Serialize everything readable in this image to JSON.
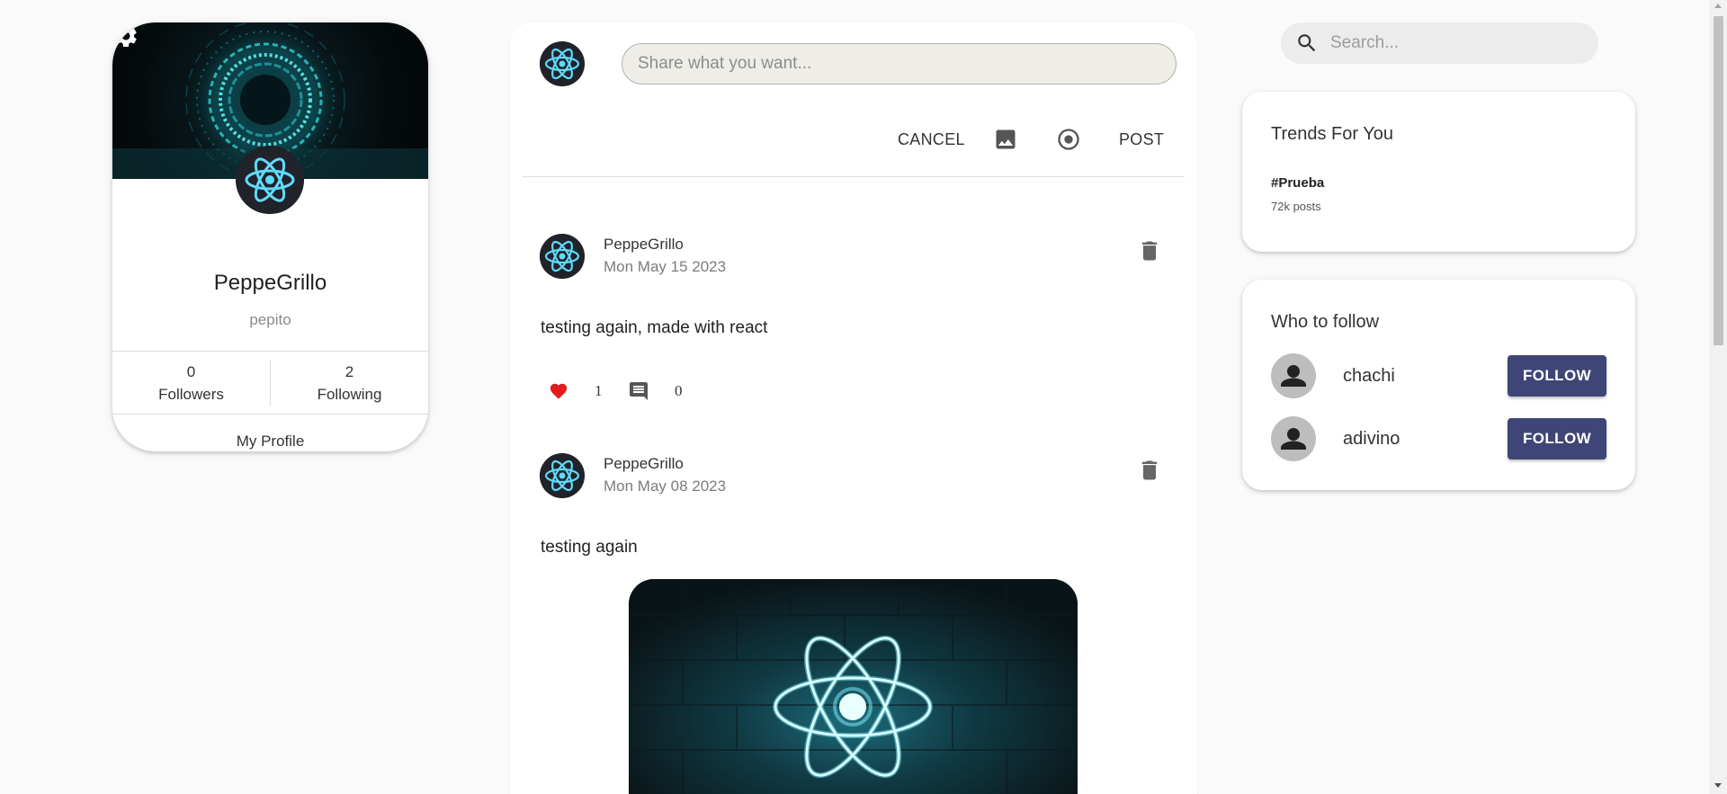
{
  "profile": {
    "display_name": "PeppeGrillo",
    "username": "pepito",
    "followers_count": "0",
    "followers_label": "Followers",
    "following_count": "2",
    "following_label": "Following",
    "my_profile_label": "My Profile",
    "settings_icon": "gear-icon"
  },
  "composer": {
    "placeholder": "Share what you want...",
    "cancel_label": "CANCEL",
    "post_label": "POST",
    "image_icon": "image-icon",
    "location_icon": "radio-target-icon"
  },
  "posts": [
    {
      "author": "PeppeGrillo",
      "date": "Mon May 15 2023",
      "text": "testing again, made with react",
      "likes": "1",
      "comments": "0"
    },
    {
      "author": "PeppeGrillo",
      "date": "Mon May 08 2023",
      "text": "testing again"
    }
  ],
  "search": {
    "placeholder": "Search..."
  },
  "trends": {
    "title": "Trends For You",
    "items": [
      {
        "tag": "#Prueba",
        "count": "72k posts"
      }
    ]
  },
  "who_to_follow": {
    "title": "Who to follow",
    "button_label": "FOLLOW",
    "users": [
      {
        "name": "chachi"
      },
      {
        "name": "adivino"
      }
    ]
  },
  "colors": {
    "accent": "#3f4677",
    "react_cyan": "#61dafb",
    "like_red": "#e11d1d"
  }
}
